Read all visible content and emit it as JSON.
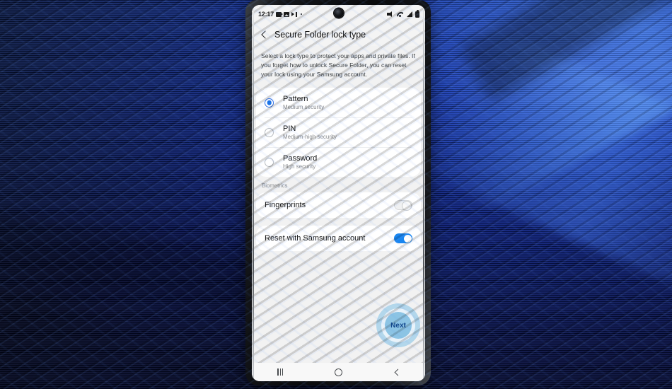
{
  "status_bar": {
    "clock": "12:17",
    "left_icons": [
      "camera-icon",
      "gallery-icon",
      "media-player-icon",
      "dot-icon"
    ],
    "right_icons": [
      "mute-icon",
      "wifi-icon",
      "signal-icon",
      "battery-icon"
    ]
  },
  "app_bar": {
    "back_icon": "back-arrow-icon",
    "title": "Secure Folder lock type"
  },
  "description": "Select a lock type to protect your apps and private files. If you forget how to unlock Secure Folder, you can reset your lock using your Samsung account.",
  "lock_types": [
    {
      "title": "Pattern",
      "subtitle": "Medium security",
      "selected": true
    },
    {
      "title": "PIN",
      "subtitle": "Medium-high security",
      "selected": false
    },
    {
      "title": "Password",
      "subtitle": "High security",
      "selected": false
    }
  ],
  "biometrics": {
    "section_header": "Biometrics",
    "items": [
      {
        "label": "Fingerprints",
        "enabled": false
      }
    ]
  },
  "reset_option": {
    "label": "Reset with Samsung account",
    "enabled": true
  },
  "next_button": {
    "label": "Next"
  },
  "nav_bar": {
    "recents_icon": "recents-icon",
    "home_icon": "home-icon",
    "back_icon": "back-icon"
  },
  "colors": {
    "accent_blue": "#1a73e8",
    "toggle_on": "#1a86f0",
    "tap_ring_outer": "#a8d2ea",
    "tap_ring_inner": "#8cc4e4",
    "next_text": "#11468c",
    "page_bg": "#f2f2f2",
    "card_bg": "#ffffff",
    "wallpaper_blue": "#0c1f78"
  }
}
